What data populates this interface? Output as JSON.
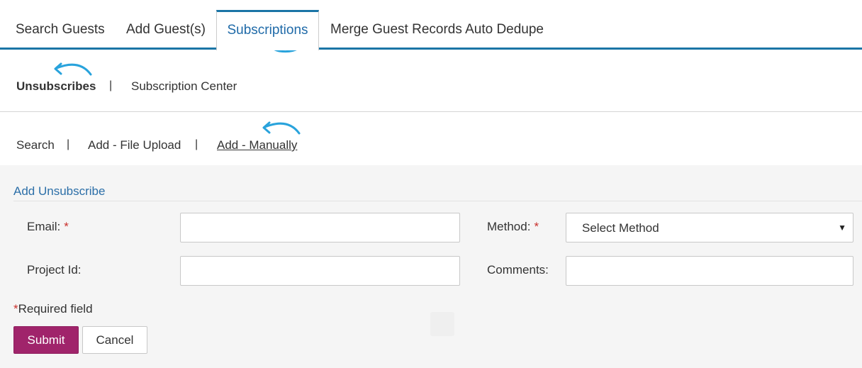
{
  "tabs": [
    {
      "label": "Search Guests",
      "active": false
    },
    {
      "label": "Add Guest(s)",
      "active": false
    },
    {
      "label": "Subscriptions",
      "active": true
    },
    {
      "label": "Merge Guest Records Auto Dedupe",
      "active": false
    }
  ],
  "subnav": {
    "items": [
      {
        "label": "Unsubscribes",
        "active": true
      },
      {
        "label": "Subscription Center",
        "active": false
      }
    ],
    "separator": "|"
  },
  "subnav3": {
    "items": [
      {
        "label": "Search",
        "active": false
      },
      {
        "label": "Add - File Upload",
        "active": false
      },
      {
        "label": "Add - Manually",
        "active": true
      }
    ],
    "separator": "|"
  },
  "form": {
    "title": "Add Unsubscribe",
    "email_label": "Email:",
    "email_value": "",
    "method_label": "Method:",
    "method_selected": "Select Method",
    "project_label": "Project Id:",
    "project_value": "",
    "comments_label": "Comments:",
    "comments_value": "",
    "required_star": "*",
    "required_note": "Required field",
    "submit_label": "Submit",
    "cancel_label": "Cancel"
  },
  "colors": {
    "accent": "#1b75a6",
    "link": "#2c6fa8",
    "submit": "#a0246b",
    "required": "#c9302c",
    "annotation_arrow": "#29a3dc"
  }
}
